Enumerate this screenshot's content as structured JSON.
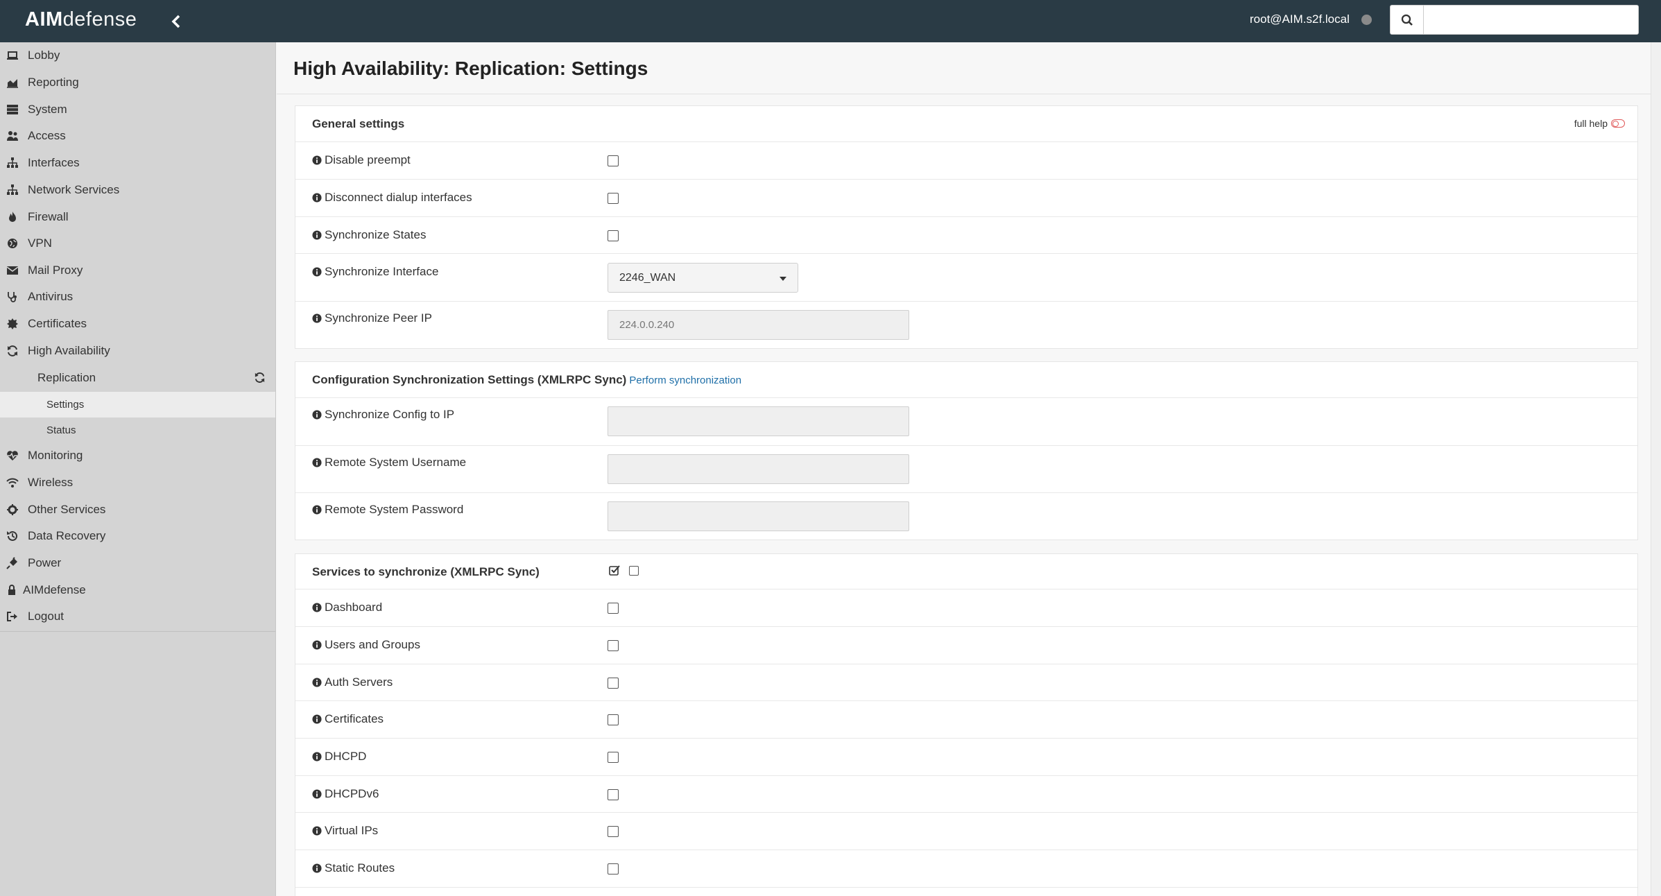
{
  "brand": {
    "logo_bold": "AIM",
    "logo_light": "defense"
  },
  "header": {
    "user": "root@AIM.s2f.local",
    "search_placeholder": ""
  },
  "sidebar": {
    "items": [
      {
        "label": "Lobby",
        "icon": "laptop-icon"
      },
      {
        "label": "Reporting",
        "icon": "area-chart-icon"
      },
      {
        "label": "System",
        "icon": "server-icon"
      },
      {
        "label": "Access",
        "icon": "users-icon"
      },
      {
        "label": "Interfaces",
        "icon": "sitemap-icon"
      },
      {
        "label": "Network Services",
        "icon": "sitemap-icon"
      },
      {
        "label": "Firewall",
        "icon": "fire-icon"
      },
      {
        "label": "VPN",
        "icon": "globe-icon"
      },
      {
        "label": "Mail Proxy",
        "icon": "envelope-icon"
      },
      {
        "label": "Antivirus",
        "icon": "stethoscope-icon"
      },
      {
        "label": "Certificates",
        "icon": "certificate-icon"
      },
      {
        "label": "High Availability",
        "icon": "refresh-icon"
      }
    ],
    "ha_sub": {
      "replication": "Replication",
      "settings": "Settings",
      "status": "Status"
    },
    "items_after": [
      {
        "label": "Monitoring",
        "icon": "heartbeat-icon"
      },
      {
        "label": "Wireless",
        "icon": "wifi-icon"
      },
      {
        "label": "Other Services",
        "icon": "cog-icon"
      },
      {
        "label": "Data Recovery",
        "icon": "history-icon"
      },
      {
        "label": "Power",
        "icon": "plug-icon"
      },
      {
        "label": "AIMdefense",
        "icon": "lock-icon"
      },
      {
        "label": "Logout",
        "icon": "sign-out-icon"
      }
    ]
  },
  "page": {
    "title": "High Availability: Replication: Settings"
  },
  "general": {
    "header": "General settings",
    "full_help": "full help",
    "disable_preempt": "Disable preempt",
    "disconnect_dialup": "Disconnect dialup interfaces",
    "sync_states": "Synchronize States",
    "sync_interface": "Synchronize Interface",
    "sync_interface_value": "2246_WAN",
    "sync_peer_ip": "Synchronize Peer IP",
    "sync_peer_ip_placeholder": "224.0.0.240"
  },
  "config_sync": {
    "header": "Configuration Synchronization Settings (XMLRPC Sync)",
    "perform_link": "Perform synchronization",
    "sync_config_ip": "Synchronize Config to IP",
    "remote_user": "Remote System Username",
    "remote_pass": "Remote System Password"
  },
  "services": {
    "header": "Services to synchronize (XMLRPC Sync)",
    "items": [
      "Dashboard",
      "Users and Groups",
      "Auth Servers",
      "Certificates",
      "DHCPD",
      "DHCPDv6",
      "Virtual IPs",
      "Static Routes"
    ]
  }
}
